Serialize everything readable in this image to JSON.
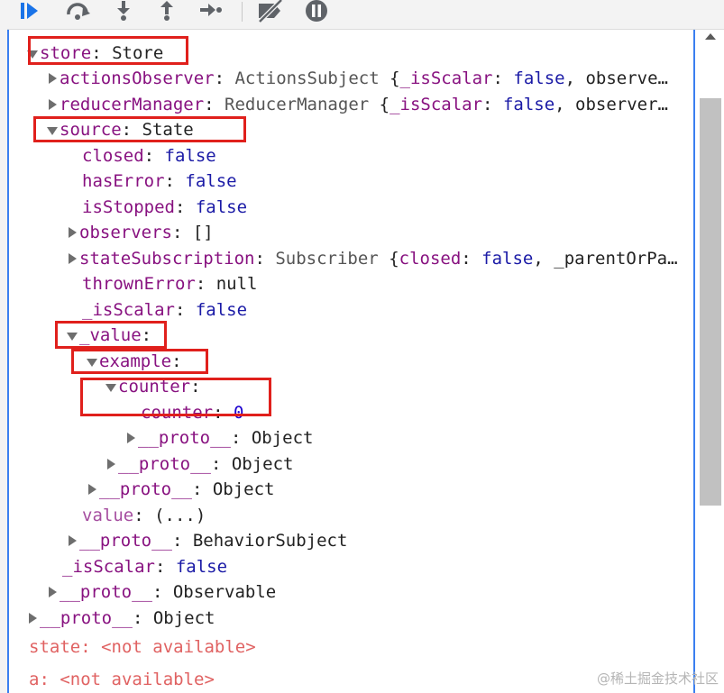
{
  "toolbar": {
    "buttons": [
      {
        "name": "resume-icon",
        "label": "Resume"
      },
      {
        "name": "step-over-icon",
        "label": "Step over"
      },
      {
        "name": "step-into-icon",
        "label": "Step into"
      },
      {
        "name": "step-out-icon",
        "label": "Step out"
      },
      {
        "name": "step-icon",
        "label": "Step"
      },
      {
        "name": "deactivate-breakpoints-icon",
        "label": "Deactivate breakpoints"
      },
      {
        "name": "pause-on-exceptions-icon",
        "label": "Pause on exceptions"
      }
    ],
    "colors": {
      "active_blue": "#1a73e8",
      "icon_gray": "#5f6368"
    }
  },
  "tree": {
    "store": {
      "key": "store",
      "sep": ": ",
      "type": "Store"
    },
    "actionsObserver": {
      "key": "actionsObserver",
      "sep": ": ",
      "cls": "ActionsSubject",
      "open": " {",
      "k1": "_isScalar",
      "s1": ": ",
      "v1": "false",
      "rest": ", observe…"
    },
    "reducerManager": {
      "key": "reducerManager",
      "sep": ": ",
      "cls": "ReducerManager",
      "open": " {",
      "k1": "_isScalar",
      "s1": ": ",
      "v1": "false",
      "rest": ", observer…"
    },
    "source": {
      "key": "source",
      "sep": ": ",
      "type": "State"
    },
    "closed": {
      "key": "closed",
      "sep": ": ",
      "value": "false"
    },
    "hasError": {
      "key": "hasError",
      "sep": ": ",
      "value": "false"
    },
    "isStopped": {
      "key": "isStopped",
      "sep": ": ",
      "value": "false"
    },
    "observers": {
      "key": "observers",
      "sep": ": ",
      "value": "[]"
    },
    "stateSubscription": {
      "key": "stateSubscription",
      "sep": ": ",
      "cls": "Subscriber",
      "open": " {",
      "k1": "closed",
      "s1": ": ",
      "v1": "false",
      "rest": ", _parentOrPa…"
    },
    "thrownError": {
      "key": "thrownError",
      "sep": ": ",
      "value": "null"
    },
    "isScalar1": {
      "key": "_isScalar",
      "sep": ": ",
      "value": "false"
    },
    "value_node": {
      "key": "_value",
      "sep": ":"
    },
    "example": {
      "key": "example",
      "sep": ":"
    },
    "counter_node": {
      "key": "counter",
      "sep": ":"
    },
    "counter_val": {
      "key": "counter",
      "sep": ": ",
      "value": "0"
    },
    "proto1": {
      "key": "__proto__",
      "sep": ": ",
      "type": "Object"
    },
    "proto2": {
      "key": "__proto__",
      "sep": ": ",
      "type": "Object"
    },
    "proto3": {
      "key": "__proto__",
      "sep": ": ",
      "type": "Object"
    },
    "value_getter": {
      "key": "value",
      "sep": ": ",
      "type": "(...)"
    },
    "proto4": {
      "key": "__proto__",
      "sep": ": ",
      "type": "BehaviorSubject"
    },
    "isScalar2": {
      "key": "_isScalar",
      "sep": ": ",
      "value": "false"
    },
    "proto5": {
      "key": "__proto__",
      "sep": ": ",
      "type": "Observable"
    },
    "proto6": {
      "key": "__proto__",
      "sep": ": ",
      "type": "Object"
    }
  },
  "scope": {
    "state": {
      "key": "state",
      "sep": ": ",
      "value": "<not available>"
    },
    "a": {
      "key": "a",
      "sep": ": ",
      "value": "<not available>"
    }
  },
  "watermark": "@稀土掘金技术社区",
  "highlight_color": "#e0201c"
}
